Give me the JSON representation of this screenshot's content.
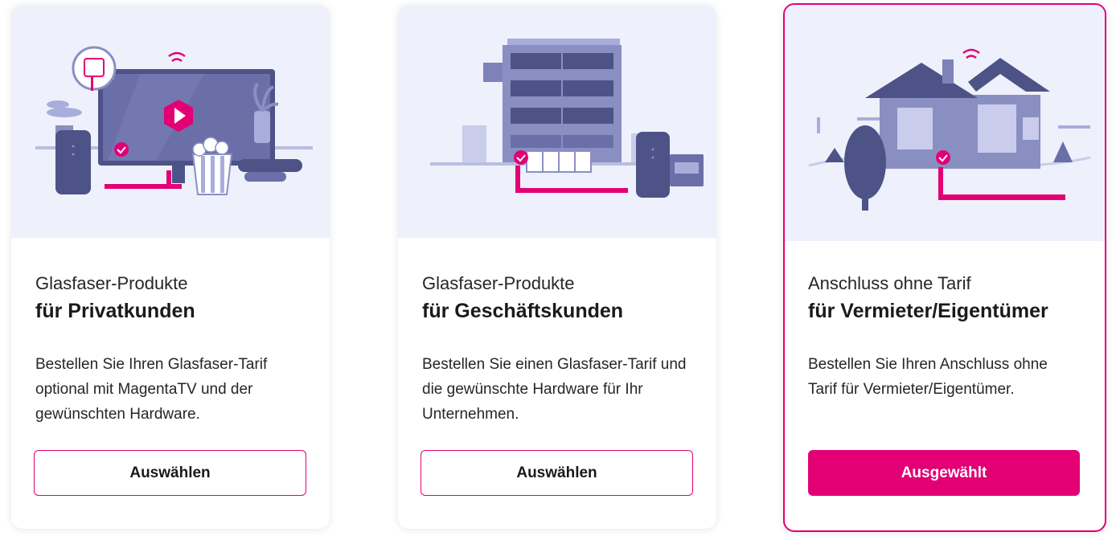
{
  "colors": {
    "accent": "#e20074",
    "illustration_bg": "#eef0fb",
    "illustration_dark": "#4d5387",
    "illustration_mid": "#7d82b8"
  },
  "cards": [
    {
      "title": "Glasfaser-Produkte",
      "subtitle": "für Privatkunden",
      "description": "Bestellen Sie Ihren Glasfaser-Tarif optional mit MagentaTV und der gewünschten Hardware.",
      "button_label": "Auswählen",
      "selected": false,
      "illustration": "home-entertainment-illustration"
    },
    {
      "title": "Glasfaser-Produkte",
      "subtitle": "für Geschäftskunden",
      "description": "Bestellen Sie einen Glasfaser-Tarif und die gewünschte Hardware für Ihr Unternehmen.",
      "button_label": "Auswählen",
      "selected": false,
      "illustration": "office-building-illustration"
    },
    {
      "title": "Anschluss ohne Tarif",
      "subtitle": "für Vermieter/Eigentümer",
      "description": "Bestellen Sie Ihren Anschluss ohne Tarif für Vermieter/Eigentümer.",
      "button_label": "Ausgewählt",
      "selected": true,
      "illustration": "house-illustration"
    }
  ]
}
